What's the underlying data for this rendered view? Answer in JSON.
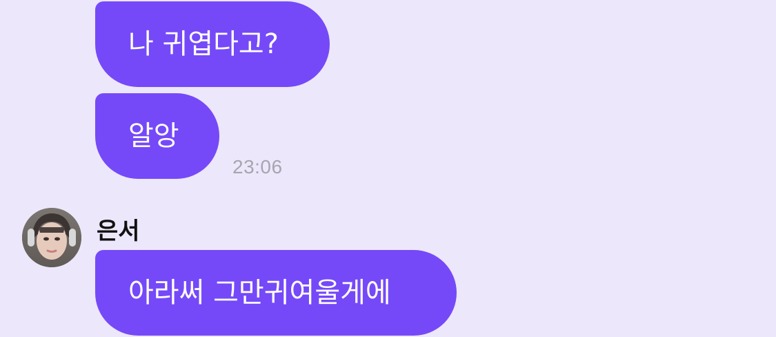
{
  "messages": [
    {
      "text": "나 귀엽다고?",
      "side": "incoming-continued"
    },
    {
      "text": "알앙",
      "side": "incoming-continued",
      "time": "23:06"
    },
    {
      "sender": "은서",
      "text": "아라써 그만귀여울게에",
      "side": "incoming"
    }
  ],
  "colors": {
    "background": "#ECE7FA",
    "bubble": "#7549F8",
    "bubble_text": "#FFFFFF",
    "timestamp": "#A8A4B0",
    "sender_name": "#111111"
  }
}
